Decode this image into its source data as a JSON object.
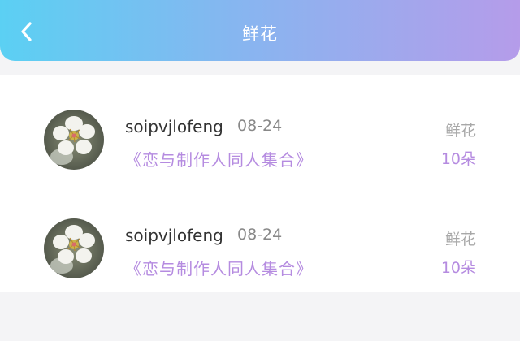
{
  "header": {
    "title": "鲜花",
    "back_icon": "chevron-left-icon"
  },
  "colors": {
    "header_gradient": [
      "#5bd0f3",
      "#86b6f0",
      "#b59cea"
    ],
    "accent": "#b58be0"
  },
  "records": [
    {
      "user": "soipvjlofeng",
      "date": "08-24",
      "book": "《恋与制作人同人集合》",
      "gift_type": "鲜花",
      "count": "10朵"
    },
    {
      "user": "soipvjlofeng",
      "date": "08-24",
      "book": "《恋与制作人同人集合》",
      "gift_type": "鲜花",
      "count": "10朵"
    }
  ]
}
